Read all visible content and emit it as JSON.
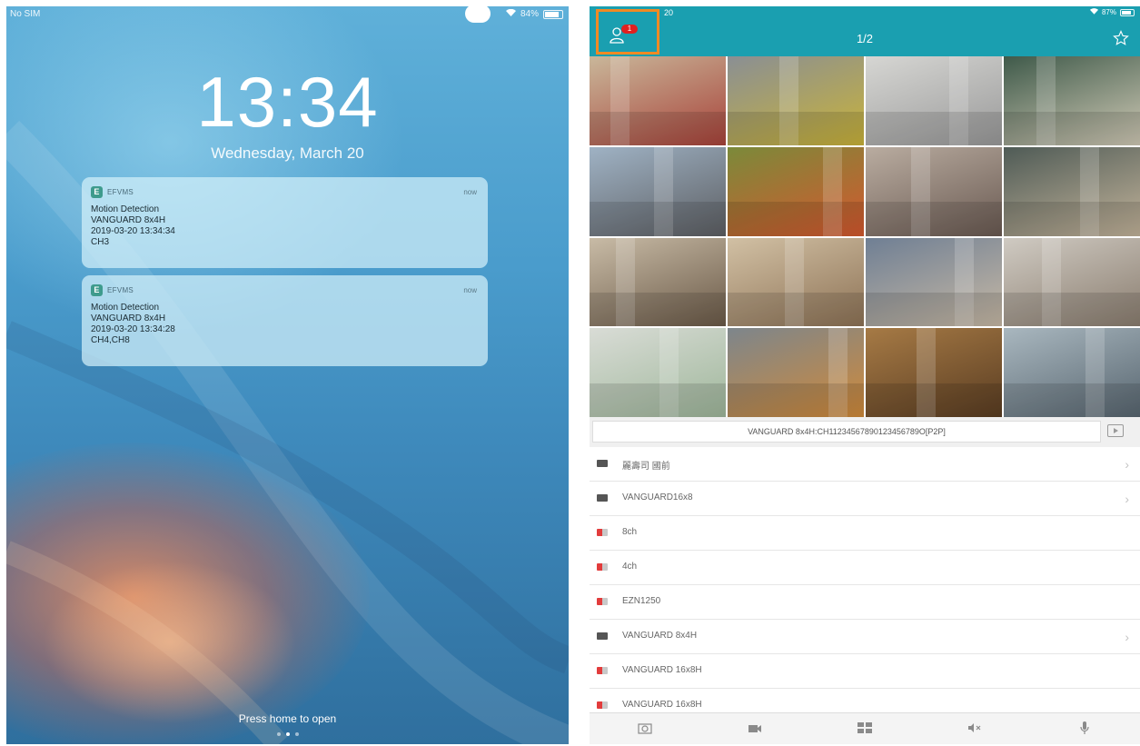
{
  "lock_screen": {
    "carrier": "No SIM",
    "battery": "84%",
    "battery_level": 0.84,
    "time": "13:34",
    "date": "Wednesday, March 20",
    "notifications": [
      {
        "app": "EFVMS",
        "when": "now",
        "lines": [
          "Motion Detection",
          "VANGUARD 8x4H",
          "2019-03-20 13:34:34",
          "CH3"
        ]
      },
      {
        "app": "EFVMS",
        "when": "now",
        "lines": [
          "Motion Detection",
          "VANGUARD 8x4H",
          "2019-03-20 13:34:28",
          "CH4,CH8"
        ]
      }
    ],
    "press_home": "Press home to open",
    "pager_dots": 3,
    "pager_active": 1
  },
  "app": {
    "status_time": "20",
    "battery": "87%",
    "battery_level": 0.87,
    "header": {
      "badge_count": "1",
      "page_indicator": "1/2",
      "accent": "#1a9fb0",
      "highlight": "#f08a24"
    },
    "camera_tiles": [
      {
        "scene": "supermarket-aisle"
      },
      {
        "scene": "bus-street"
      },
      {
        "scene": "elevator-lobby"
      },
      {
        "scene": "shopping-arcade"
      },
      {
        "scene": "airport-plane"
      },
      {
        "scene": "fruit-market"
      },
      {
        "scene": "busy-street"
      },
      {
        "scene": "mall-escalator"
      },
      {
        "scene": "mall-atrium"
      },
      {
        "scene": "mall-escalator-2"
      },
      {
        "scene": "food-court"
      },
      {
        "scene": "mall-interior"
      },
      {
        "scene": "hospital-corridor"
      },
      {
        "scene": "metro-train"
      },
      {
        "scene": "library-hall"
      },
      {
        "scene": "glass-entrance"
      }
    ],
    "selected_channel": "VANGUARD 8x4H:CH11234567890123456789O[P2P]",
    "devices": [
      {
        "name": "麗壽司 國前",
        "type": "dvr",
        "has_chevron": true
      },
      {
        "name": "VANGUARD16x8",
        "type": "dvr",
        "has_chevron": true
      },
      {
        "name": "8ch",
        "type": "ipc",
        "has_chevron": false
      },
      {
        "name": "4ch",
        "type": "ipc",
        "has_chevron": false
      },
      {
        "name": "EZN1250",
        "type": "ipc",
        "has_chevron": false
      },
      {
        "name": "VANGUARD 8x4H",
        "type": "dvr",
        "has_chevron": true
      },
      {
        "name": "VANGUARD 16x8H",
        "type": "ipc",
        "has_chevron": false
      },
      {
        "name": "VANGUARD 16x8H",
        "type": "ipc",
        "has_chevron": false
      }
    ],
    "tabbar": [
      {
        "icon": "snapshot-icon"
      },
      {
        "icon": "record-icon"
      },
      {
        "icon": "layout-icon"
      },
      {
        "icon": "mute-icon"
      },
      {
        "icon": "microphone-icon"
      }
    ]
  }
}
